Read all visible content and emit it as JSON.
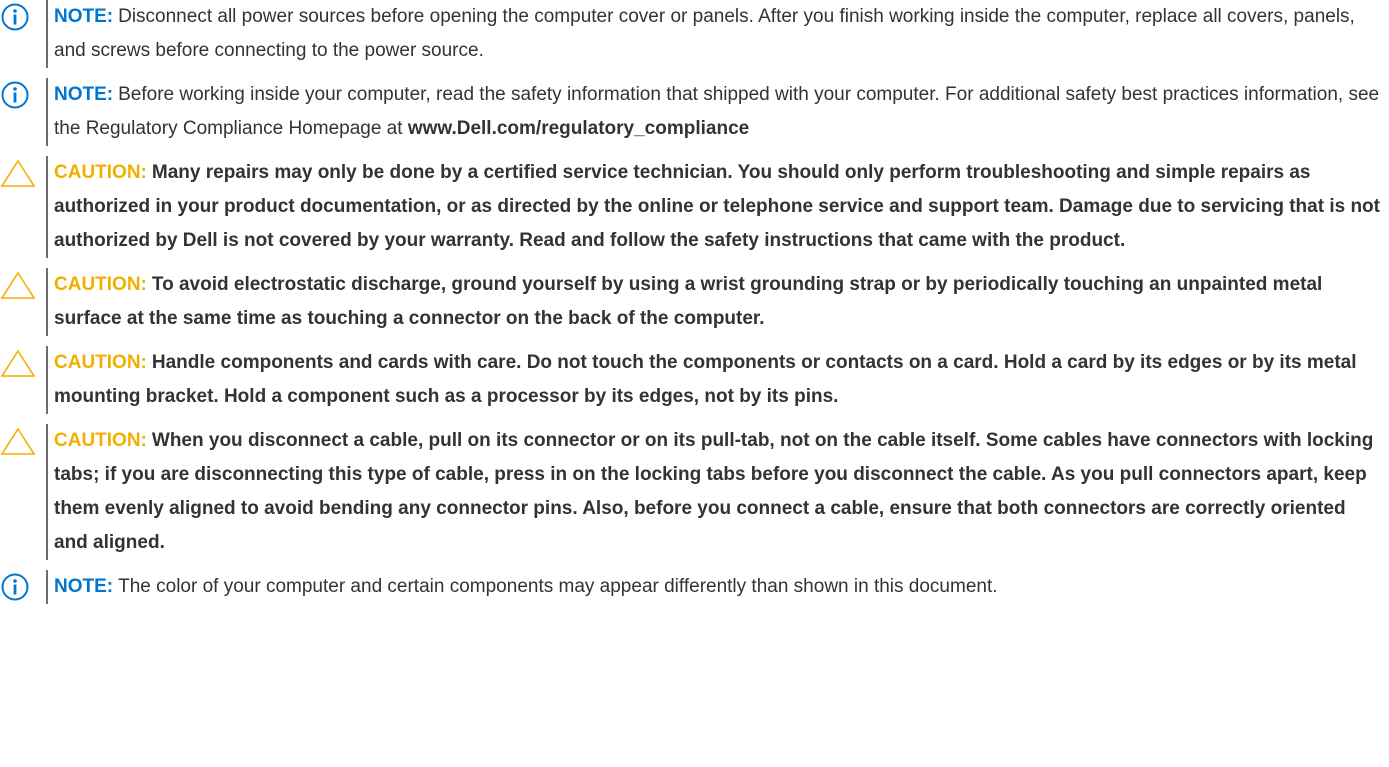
{
  "colors": {
    "note_label": "#0076ce",
    "caution_label": "#f2af00",
    "body_text": "#333333",
    "rule": "#6e6e6e"
  },
  "notices": [
    {
      "type": "note",
      "icon": "info-circle-icon",
      "label": "NOTE:",
      "text": "Disconnect all power sources before opening the computer cover or panels. After you finish working inside the computer, replace all covers, panels, and screws before connecting to the power source."
    },
    {
      "type": "note",
      "icon": "info-circle-icon",
      "label": "NOTE:",
      "text": "Before working inside your computer, read the safety information that shipped with your computer. For additional safety best practices information, see the Regulatory Compliance Homepage at",
      "emphasis": "www.Dell.com/regulatory_compliance"
    },
    {
      "type": "caution",
      "icon": "warning-triangle-icon",
      "label": "CAUTION:",
      "text": "Many repairs may only be done by a certified service technician. You should only perform troubleshooting and simple repairs as authorized in your product documentation, or as directed by the online or telephone service and support team. Damage due to servicing that is not authorized by Dell is not covered by your warranty. Read and follow the safety instructions that came with the product."
    },
    {
      "type": "caution",
      "icon": "warning-triangle-icon",
      "label": "CAUTION:",
      "text": "To avoid electrostatic discharge, ground yourself by using a wrist grounding strap or by periodically touching an unpainted metal surface at the same time as touching a connector on the back of the computer."
    },
    {
      "type": "caution",
      "icon": "warning-triangle-icon",
      "label": "CAUTION:",
      "text": "Handle components and cards with care. Do not touch the components or contacts on a card. Hold a card by its edges or by its metal mounting bracket. Hold a component such as a processor by its edges, not by its pins."
    },
    {
      "type": "caution",
      "icon": "warning-triangle-icon",
      "label": "CAUTION:",
      "text": "When you disconnect a cable, pull on its connector or on its pull-tab, not on the cable itself. Some cables have connectors with locking tabs; if you are disconnecting this type of cable, press in on the locking tabs before you disconnect the cable. As you pull connectors apart, keep them evenly aligned to avoid bending any connector pins. Also, before you connect a cable, ensure that both connectors are correctly oriented and aligned."
    },
    {
      "type": "note",
      "icon": "info-circle-icon",
      "label": "NOTE:",
      "text": "The color of your computer and certain components may appear differently than shown in this document."
    }
  ]
}
